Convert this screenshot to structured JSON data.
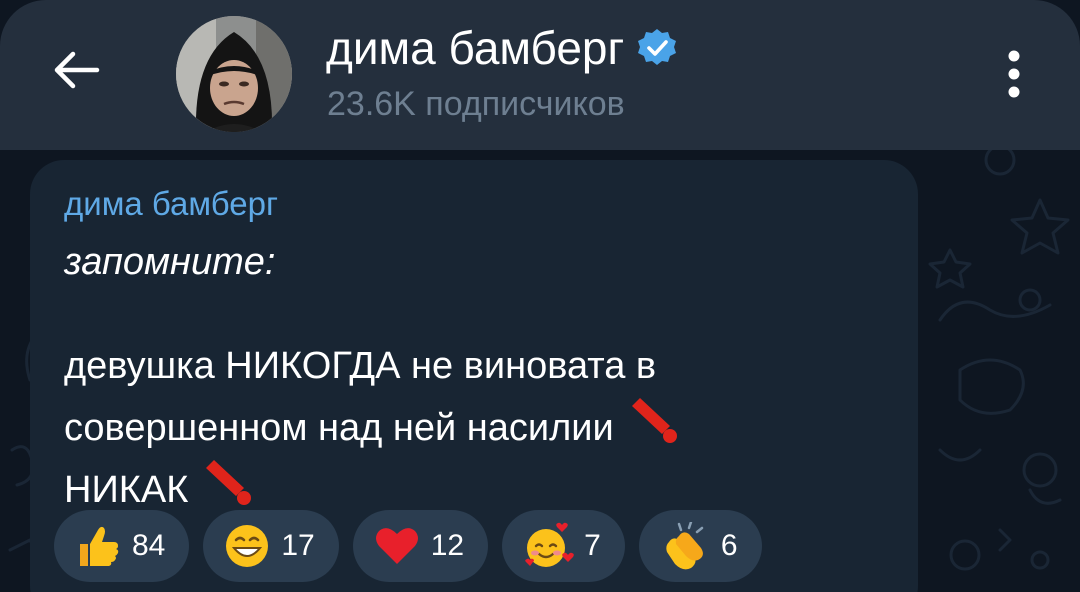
{
  "header": {
    "channel_name": "дима бамберг",
    "subscribers": "23.6K подписчиков",
    "back_icon": "arrow-left-icon",
    "menu_icon": "more-vertical-icon",
    "verified_icon": "verified-badge-icon"
  },
  "message": {
    "author": "дима бамберг",
    "line1": "запомните:",
    "line2": "девушка НИКОГДА не виновата в",
    "line3": "совершенном над ней насилии",
    "line4": "НИКАК"
  },
  "reactions": [
    {
      "icon": "thumbs-up-icon",
      "count": "84"
    },
    {
      "icon": "grinning-face-icon",
      "count": "17"
    },
    {
      "icon": "heart-icon",
      "count": "12"
    },
    {
      "icon": "smiling-face-with-hearts-icon",
      "count": "7"
    },
    {
      "icon": "clapping-hands-icon",
      "count": "6"
    }
  ],
  "colors": {
    "header_bg": "#242f3d",
    "bubble_bg": "#182533",
    "accent": "#5fa9e6",
    "subtle_text": "#6e7f91",
    "reaction_bg": "#2b3d50"
  }
}
